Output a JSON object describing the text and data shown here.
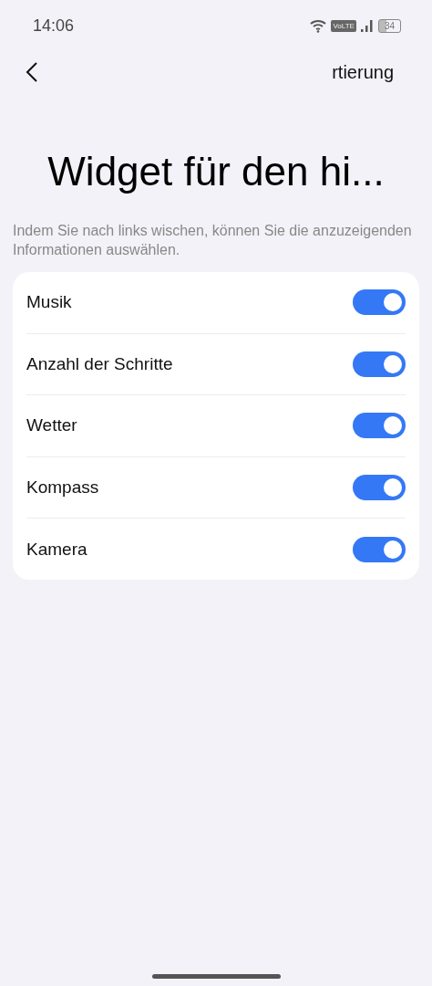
{
  "status_bar": {
    "time": "14:06",
    "network": "VoLTE",
    "battery": "34"
  },
  "header": {
    "action": "rtierung"
  },
  "title": "Widget für den hi...",
  "description": "Indem Sie nach links wischen, können Sie die anzuzeigenden Informationen auswählen.",
  "items": [
    {
      "label": "Musik",
      "on": true
    },
    {
      "label": "Anzahl der Schritte",
      "on": true
    },
    {
      "label": "Wetter",
      "on": true
    },
    {
      "label": "Kompass",
      "on": true
    },
    {
      "label": "Kamera",
      "on": true
    }
  ]
}
